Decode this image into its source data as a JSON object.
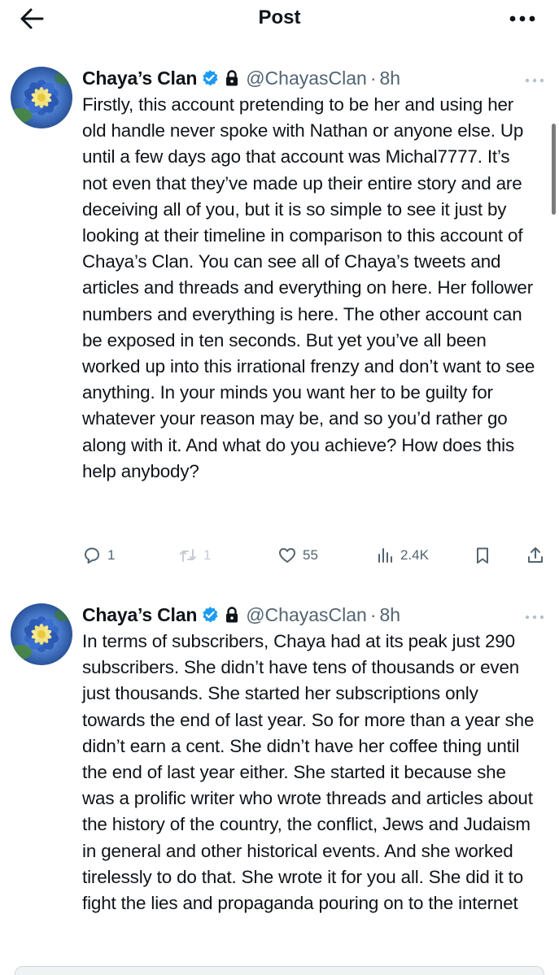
{
  "header": {
    "title": "Post",
    "back_icon": "arrow-left-icon",
    "more_icon": "more-horizontal-icon"
  },
  "colors": {
    "text": "#0f1419",
    "muted": "#536471",
    "verified_badge": "#1d9bf0",
    "background": "#ffffff"
  },
  "tweets": [
    {
      "name": "Chaya’s Clan",
      "handle": "@ChayasClan",
      "dot": "·",
      "time": "8h",
      "verified": true,
      "locked": true,
      "text": "Firstly, this account pretending to be her and using her old handle never spoke with Nathan or anyone else. Up until a few days ago that account was Michal7777. It’s not even that they’ve made up their entire story and are deceiving all of you, but it is so simple to see it just by looking at their timeline in comparison to this account of Chaya’s Clan. You can see all of Chaya’s tweets and articles and threads and everything on here. Her follower numbers and everything is here. The other account can be exposed in ten seconds. But yet you’ve all been worked up into this irrational frenzy and don’t want to see anything. In your minds you want her to be guilty for whatever your reason may be, and so you’d rather go along with it. And what do you achieve? How does this help anybody?",
      "replies": "1",
      "reposts": "1",
      "likes": "55",
      "views": "2.4K"
    },
    {
      "name": "Chaya’s Clan",
      "handle": "@ChayasClan",
      "dot": "·",
      "time": "8h",
      "verified": true,
      "locked": true,
      "text": "In terms of subscribers, Chaya had at its peak just 290 subscribers. She didn’t have tens of thousands or even just thousands. She started her subscriptions only towards the end of last year. So for more than a year she didn’t earn a cent. She didn’t have her coffee thing until the end of last year either. She started it because she was a prolific writer who wrote threads and articles about the history of the country, the conflict, Jews and Judaism in general and other historical events. And she worked tirelessly to do that. She wrote it for you all. She did it to fight the lies and propaganda pouring on to the internet"
    }
  ]
}
